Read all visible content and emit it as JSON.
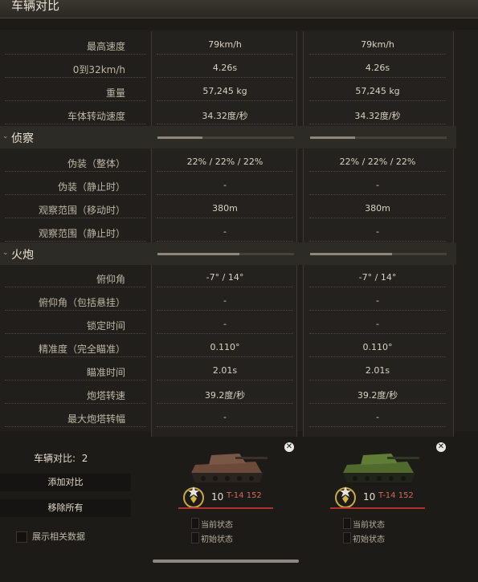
{
  "title": "车辆对比",
  "speed_rows": [
    {
      "label": "最高速度",
      "v1": "79km/h",
      "v2": "79km/h"
    },
    {
      "label": "0到32km/h",
      "v1": "4.26s",
      "v2": "4.26s"
    },
    {
      "label": "重量",
      "v1": "57,245 kg",
      "v2": "57,245 kg"
    },
    {
      "label": "车体转动速度",
      "v1": "34.32度/秒",
      "v2": "34.32度/秒"
    }
  ],
  "section_scout": {
    "name": "侦察",
    "bar1": 0.33,
    "bar2": 0.33
  },
  "scout_rows": [
    {
      "label": "伪装（整体）",
      "v1": "22% / 22% / 22%",
      "v2": "22% / 22% / 22%"
    },
    {
      "label": "伪装（静止时）",
      "v1": "-",
      "v2": "-"
    },
    {
      "label": "观察范围（移动时）",
      "v1": "380m",
      "v2": "380m"
    },
    {
      "label": "观察范围（静止时）",
      "v1": "-",
      "v2": "-"
    }
  ],
  "section_gun": {
    "name": "火炮",
    "bar1": 0.6,
    "bar2": 0.6
  },
  "gun_rows": [
    {
      "label": "俯仰角",
      "v1": "-7°   / 14°",
      "v2": "-7°   / 14°"
    },
    {
      "label": "俯仰角（包括悬挂）",
      "v1": "-",
      "v2": "-"
    },
    {
      "label": "锁定时间",
      "v1": "-",
      "v2": "-"
    },
    {
      "label": "精准度（完全瞄准）",
      "v1": "0.110°",
      "v2": "0.110°"
    },
    {
      "label": "瞄准时间",
      "v1": "2.01s",
      "v2": "2.01s"
    },
    {
      "label": "炮塔转速",
      "v1": "39.2度/秒",
      "v2": "39.2度/秒"
    },
    {
      "label": "最大炮塔转幅",
      "v1": "-",
      "v2": "-"
    }
  ],
  "compare": {
    "label": "车辆对比:",
    "count": "2"
  },
  "add_button": "添加对比",
  "remove_button": "移除所有",
  "show_related": "展示相关数据",
  "vehicles": [
    {
      "tier": "10",
      "name": "T-14 152",
      "state_current": "当前状态",
      "state_initial": "初始状态",
      "camo": "#6b4a3a"
    },
    {
      "tier": "10",
      "name": "T-14 152",
      "state_current": "当前状态",
      "state_initial": "初始状态",
      "camo": "#4f6a2c"
    }
  ]
}
